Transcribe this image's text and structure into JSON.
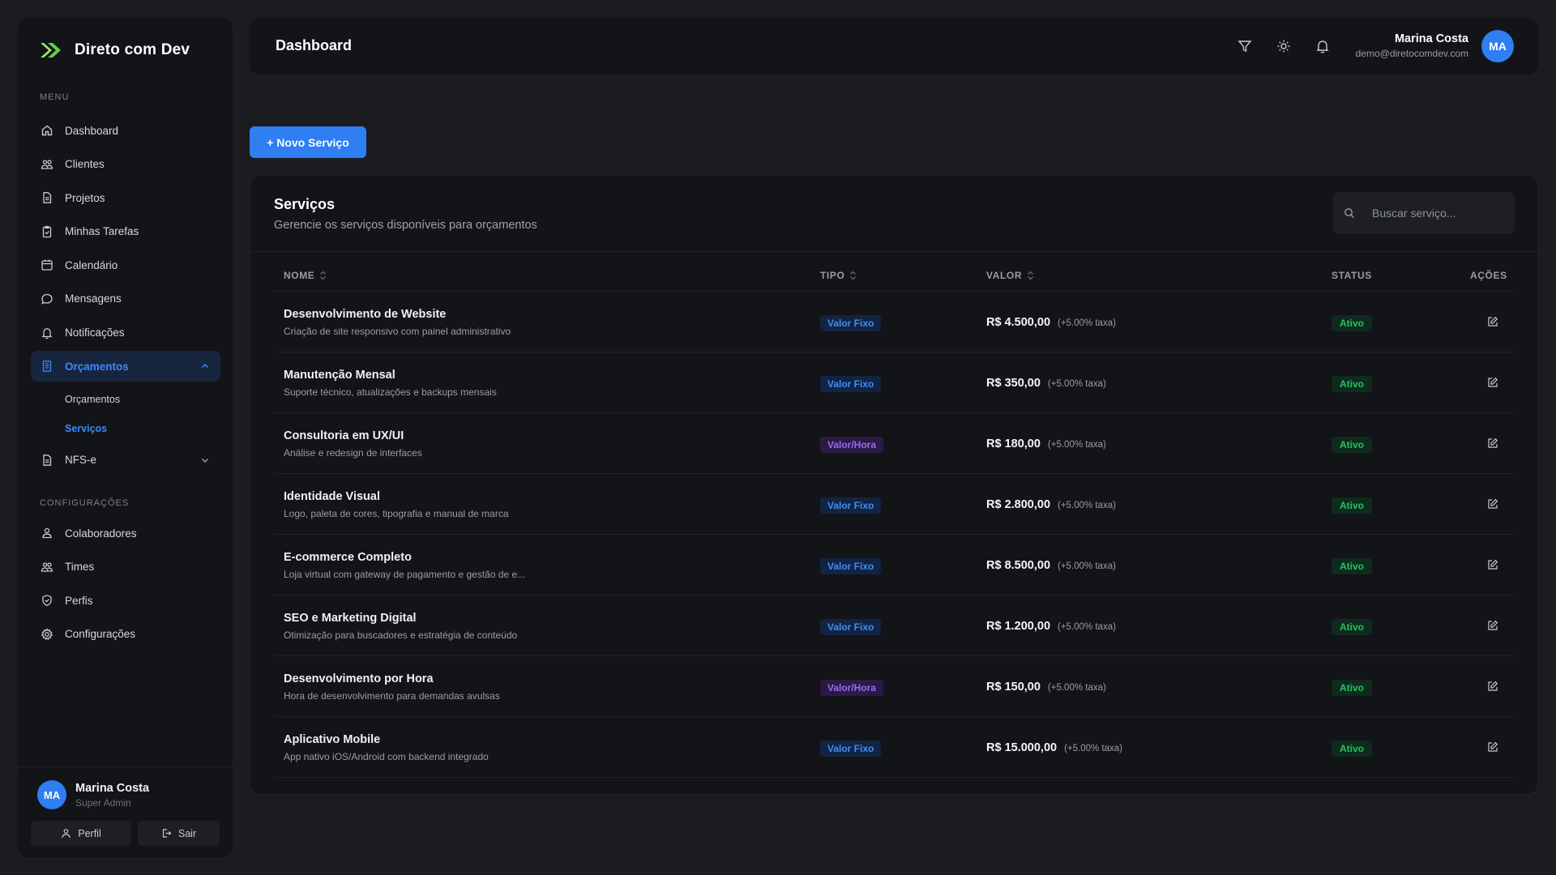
{
  "app": {
    "name": "Direto com Dev",
    "brand_color": "#2f7ef2"
  },
  "sidebar": {
    "menu_label": "MENU",
    "config_label": "CONFIGURAÇÕES",
    "items": [
      {
        "label": "Dashboard",
        "icon": "home-icon"
      },
      {
        "label": "Clientes",
        "icon": "users-icon"
      },
      {
        "label": "Projetos",
        "icon": "file-icon"
      },
      {
        "label": "Minhas Tarefas",
        "icon": "clipboard-icon"
      },
      {
        "label": "Calendário",
        "icon": "calendar-icon"
      },
      {
        "label": "Mensagens",
        "icon": "message-icon"
      },
      {
        "label": "Notificações",
        "icon": "bell-icon"
      },
      {
        "label": "Orçamentos",
        "icon": "document-icon",
        "expanded": true
      },
      {
        "label": "NFS-e",
        "icon": "file-icon",
        "expanded": false
      }
    ],
    "sub_items": [
      {
        "label": "Orçamentos"
      },
      {
        "label": "Serviços"
      }
    ],
    "config_items": [
      {
        "label": "Colaboradores",
        "icon": "user-group-icon"
      },
      {
        "label": "Times",
        "icon": "team-icon"
      },
      {
        "label": "Perfis",
        "icon": "shield-icon"
      },
      {
        "label": "Configurações",
        "icon": "gear-icon"
      }
    ],
    "user": {
      "initials": "MA",
      "name": "Marina Costa",
      "role": "Super Admin"
    },
    "profile_button": "Perfil",
    "logout_button": "Sair"
  },
  "header": {
    "title": "Dashboard",
    "user": {
      "name": "Marina Costa",
      "email": "demo@diretocomdev.com",
      "initials": "MA"
    }
  },
  "actions": {
    "new_service": "+ Novo Serviço"
  },
  "card": {
    "title": "Serviços",
    "subtitle": "Gerencie os serviços disponíveis para orçamentos",
    "search_placeholder": "Buscar serviço..."
  },
  "table": {
    "columns": {
      "nome": "NOME",
      "tipo": "TIPO",
      "valor": "VALOR",
      "status": "STATUS",
      "acoes": "AÇÕES"
    },
    "rows": [
      {
        "name": "Desenvolvimento de Website",
        "desc": "Criação de site responsivo com painel administrativo",
        "tipo": "Valor Fixo",
        "valor": "R$ 4.500,00",
        "taxa": "(+5.00% taxa)",
        "status": "Ativo"
      },
      {
        "name": "Manutenção Mensal",
        "desc": "Suporte técnico, atualizações e backups mensais",
        "tipo": "Valor Fixo",
        "valor": "R$ 350,00",
        "taxa": "(+5.00% taxa)",
        "status": "Ativo"
      },
      {
        "name": "Consultoria em UX/UI",
        "desc": "Análise e redesign de interfaces",
        "tipo": "Valor/Hora",
        "valor": "R$ 180,00",
        "taxa": "(+5.00% taxa)",
        "status": "Ativo"
      },
      {
        "name": "Identidade Visual",
        "desc": "Logo, paleta de cores, tipografia e manual de marca",
        "tipo": "Valor Fixo",
        "valor": "R$ 2.800,00",
        "taxa": "(+5.00% taxa)",
        "status": "Ativo"
      },
      {
        "name": "E-commerce Completo",
        "desc": "Loja virtual com gateway de pagamento e gestão de e...",
        "tipo": "Valor Fixo",
        "valor": "R$ 8.500,00",
        "taxa": "(+5.00% taxa)",
        "status": "Ativo"
      },
      {
        "name": "SEO e Marketing Digital",
        "desc": "Otimização para buscadores e estratégia de conteúdo",
        "tipo": "Valor Fixo",
        "valor": "R$ 1.200,00",
        "taxa": "(+5.00% taxa)",
        "status": "Ativo"
      },
      {
        "name": "Desenvolvimento por Hora",
        "desc": "Hora de desenvolvimento para demandas avulsas",
        "tipo": "Valor/Hora",
        "valor": "R$ 150,00",
        "taxa": "(+5.00% taxa)",
        "status": "Ativo"
      },
      {
        "name": "Aplicativo Mobile",
        "desc": "App nativo iOS/Android com backend integrado",
        "tipo": "Valor Fixo",
        "valor": "R$ 15.000,00",
        "taxa": "(+5.00% taxa)",
        "status": "Ativo"
      }
    ]
  }
}
